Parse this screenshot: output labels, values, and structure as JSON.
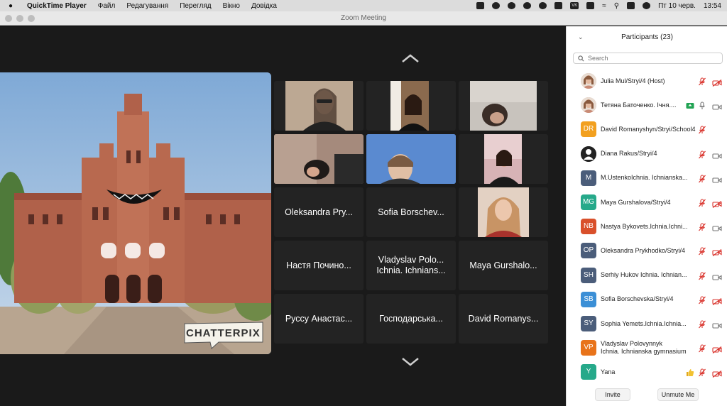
{
  "menubar": {
    "app": "QuickTime Player",
    "items": [
      "Файл",
      "Редагування",
      "Перегляд",
      "Вікно",
      "Довідка"
    ],
    "vk_label": "VK",
    "date": "Пт 10 черв.",
    "time": "13:54"
  },
  "window": {
    "title": "Zoom Meeting"
  },
  "shared": {
    "badge_left": "CHATTER",
    "badge_right": "PIX"
  },
  "tiles": [
    {
      "name": "",
      "video": true,
      "tone": "#b9a793"
    },
    {
      "name": "",
      "video": true,
      "tone": "#8a6a4e"
    },
    {
      "name": "",
      "video": true,
      "tone": "#c8c3bd"
    },
    {
      "name": "",
      "video": true,
      "tone": "#a58a7c"
    },
    {
      "name": "",
      "video": true,
      "tone": "#4b7dc4"
    },
    {
      "name": "",
      "video": true,
      "tone": "#d7b3b6"
    },
    {
      "name": "Oleksandra Pry...",
      "video": false
    },
    {
      "name": "Sofia Borschev...",
      "video": false
    },
    {
      "name": "",
      "video": true,
      "tone": "#d9c3b3"
    },
    {
      "name": "Настя Почино...",
      "video": false
    },
    {
      "name": "Vladyslav Polo...\nIchnia. Ichnians...",
      "video": false
    },
    {
      "name": "Maya Gurshalo...",
      "video": false
    },
    {
      "name": "Руссу Анастас...",
      "video": false
    },
    {
      "name": "Господарська...",
      "video": false
    },
    {
      "name": "David Romanys...",
      "video": false
    }
  ],
  "participants": {
    "title": "Participants (23)",
    "search_placeholder": "Search",
    "list": [
      {
        "name": "Julia Mul/Stryi/4 (Host)",
        "initials": "",
        "color": "#c9a48d",
        "photo": true,
        "mic": "muted",
        "cam": "off"
      },
      {
        "name": "Тетяна Баточенко. Ічня....",
        "initials": "",
        "color": "#b88b77",
        "photo": true,
        "mic": "on",
        "cam": "on",
        "extra": "share"
      },
      {
        "name": "David Romanyshyn/Stryi/School4",
        "initials": "DR",
        "color": "#f2a01f",
        "mic": "muted",
        "cam": "none"
      },
      {
        "name": "Diana Rakus/Stryi/4",
        "initials": "",
        "color": "#222222",
        "silhouette": true,
        "mic": "muted",
        "cam": "on"
      },
      {
        "name": "M.UstenkoIchnia. Ichnianska...",
        "initials": "M",
        "color": "#4b5d7a",
        "mic": "muted",
        "cam": "on"
      },
      {
        "name": "Maya Gurshalova/Stryi/4",
        "initials": "MG",
        "color": "#26a98a",
        "mic": "muted",
        "cam": "off"
      },
      {
        "name": "Nastya Bykovets.Ichnia.Ichni...",
        "initials": "NB",
        "color": "#d9502b",
        "mic": "muted",
        "cam": "on"
      },
      {
        "name": "Oleksandra Prykhodko/Stryi/4",
        "initials": "OP",
        "color": "#4b5d7a",
        "mic": "muted",
        "cam": "off"
      },
      {
        "name": "Serhiy Hukov Ichnia. Ichnian...",
        "initials": "SH",
        "color": "#4b5d7a",
        "mic": "muted",
        "cam": "on"
      },
      {
        "name": "Sofia Borschevska/Stryi/4",
        "initials": "SB",
        "color": "#3b8fd6",
        "mic": "muted",
        "cam": "off"
      },
      {
        "name": "Sophia Yemets.Ichnia.Ichnia...",
        "initials": "SY",
        "color": "#4b5d7a",
        "mic": "muted",
        "cam": "on"
      },
      {
        "name": "Vladyslav Polovynnyk\nIchnia. Ichnianska gymnasium",
        "initials": "VP",
        "color": "#e8731a",
        "mic": "muted",
        "cam": "off"
      },
      {
        "name": "Yana",
        "initials": "Y",
        "color": "#26a98a",
        "mic": "muted",
        "cam": "off",
        "extra": "thumb"
      }
    ],
    "invite_label": "Invite",
    "unmute_label": "Unmute Me"
  }
}
